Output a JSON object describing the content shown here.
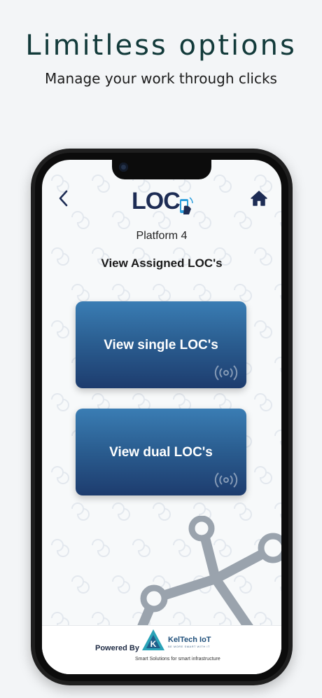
{
  "promo": {
    "headline": "Limitless options",
    "subheadline": "Manage your work through clicks"
  },
  "app": {
    "logo_text": "LOC",
    "platform": "Platform 4",
    "section_title": "View Assigned LOC's",
    "buttons": [
      {
        "label": "View single LOC's"
      },
      {
        "label": "View dual LOC's"
      }
    ],
    "footer": {
      "powered_by": "Powered By",
      "company": "KelTech IoT",
      "company_small": "BE MORE SMART WITH IT",
      "tagline": "Smart Solutions for smart infrastructure"
    }
  },
  "icons": {
    "back": "chevron-left-icon",
    "home": "home-icon",
    "nfc": "nfc-signal-icon"
  },
  "colors": {
    "headline": "#123a3a",
    "button_top": "#3a7db4",
    "button_bottom": "#1d3c6e",
    "logo": "#1d2c54"
  }
}
